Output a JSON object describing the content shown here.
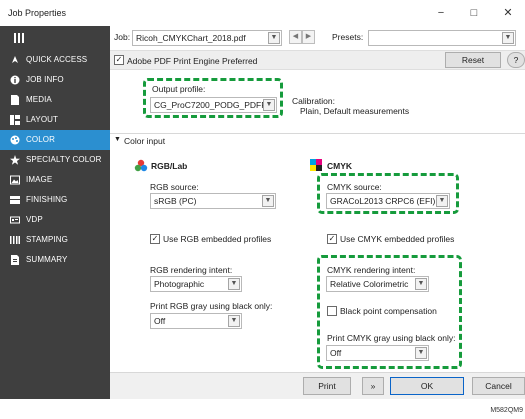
{
  "window": {
    "title": "Job Properties",
    "minimize_glyph": "−",
    "maximize_glyph": "□",
    "close_glyph": "✕"
  },
  "sidebar": {
    "accent": "#2b8fd0",
    "background": "#3f3f3f",
    "items": [
      {
        "label": "QUICK ACCESS",
        "icon": "rocket-icon",
        "active": false
      },
      {
        "label": "JOB INFO",
        "icon": "info-icon",
        "active": false
      },
      {
        "label": "MEDIA",
        "icon": "paper-icon",
        "active": false
      },
      {
        "label": "LAYOUT",
        "icon": "layout-icon",
        "active": false
      },
      {
        "label": "COLOR",
        "icon": "color-icon",
        "active": true
      },
      {
        "label": "SPECIALTY COLOR",
        "icon": "star-icon",
        "active": false
      },
      {
        "label": "IMAGE",
        "icon": "image-icon",
        "active": false
      },
      {
        "label": "FINISHING",
        "icon": "finishing-icon",
        "active": false
      },
      {
        "label": "VDP",
        "icon": "vdp-icon",
        "active": false
      },
      {
        "label": "STAMPING",
        "icon": "stamping-icon",
        "active": false
      },
      {
        "label": "SUMMARY",
        "icon": "summary-icon",
        "active": false
      }
    ]
  },
  "jobbar": {
    "job_label": "Job:",
    "job_value": "Ricoh_CMYKChart_2018.pdf",
    "presets_label": "Presets:",
    "presets_value": ""
  },
  "engine": {
    "checkbox_label": "Adobe PDF Print Engine Preferred",
    "checked": true,
    "reset_label": "Reset",
    "help_glyph": "?"
  },
  "output": {
    "label": "Output profile:",
    "value": "CG_ProC7200_PODG_PDFFla...",
    "calibration_label": "Calibration:",
    "calibration_value": "Plain, Default measurements"
  },
  "color_input": {
    "section_label": "Color input",
    "rgb": {
      "title": "RGB/Lab",
      "source_label": "RGB source:",
      "source_value": "sRGB (PC)",
      "embedded_label": "Use RGB embedded profiles",
      "embedded_checked": true,
      "intent_label": "RGB rendering intent:",
      "intent_value": "Photographic",
      "gray_label": "Print RGB gray using black only:",
      "gray_value": "Off"
    },
    "cmyk": {
      "title": "CMYK",
      "source_label": "CMYK source:",
      "source_value": "GRACoL2013 CRPC6 (EFI)",
      "embedded_label": "Use CMYK embedded profiles",
      "embedded_checked": true,
      "intent_label": "CMYK rendering intent:",
      "intent_value": "Relative Colorimetric",
      "bpc_label": "Black point compensation",
      "bpc_checked": false,
      "gray_label": "Print CMYK gray using black only:",
      "gray_value": "Off"
    }
  },
  "footer": {
    "print_label": "Print",
    "print_arrow": "»",
    "ok_label": "OK",
    "cancel_label": "Cancel"
  },
  "highlight_color": "#169b3c",
  "figure_ref": "M582QM9"
}
